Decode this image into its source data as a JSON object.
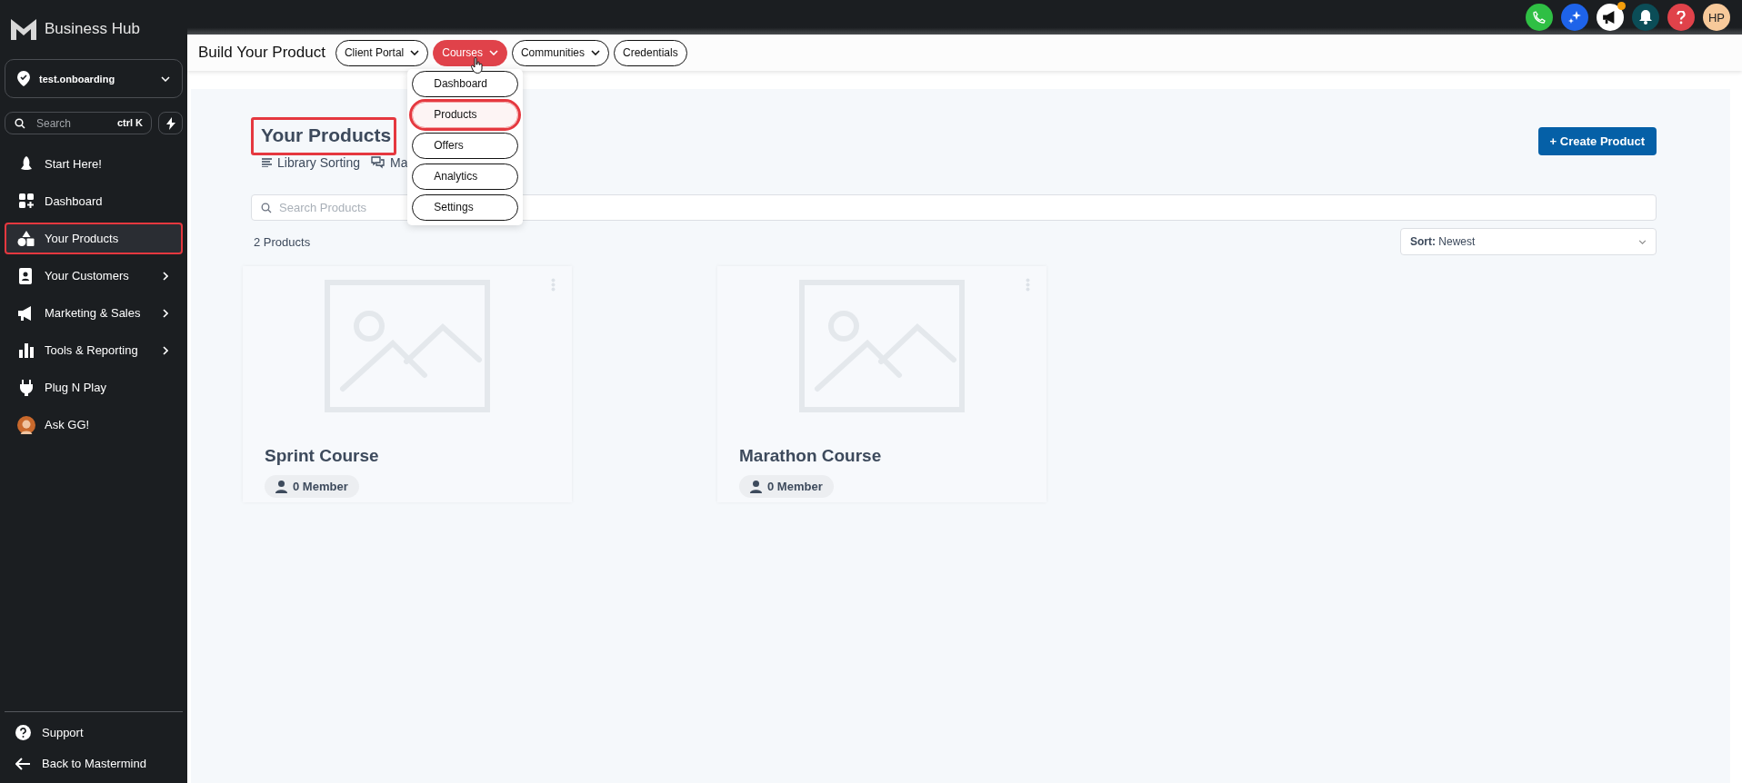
{
  "sidebar": {
    "brand": "Business Hub",
    "location": "test.onboarding",
    "search": {
      "placeholder": "Search",
      "shortcut": "ctrl K"
    },
    "items": [
      {
        "label": "Start Here!",
        "has_submenu": false,
        "selected": false,
        "annotated": false
      },
      {
        "label": "Dashboard",
        "has_submenu": false,
        "selected": false,
        "annotated": false
      },
      {
        "label": "Your Products",
        "has_submenu": false,
        "selected": true,
        "annotated": true
      },
      {
        "label": "Your Customers",
        "has_submenu": true,
        "selected": false,
        "annotated": false
      },
      {
        "label": "Marketing & Sales",
        "has_submenu": true,
        "selected": false,
        "annotated": false
      },
      {
        "label": "Tools & Reporting",
        "has_submenu": true,
        "selected": false,
        "annotated": false
      },
      {
        "label": "Plug N Play",
        "has_submenu": false,
        "selected": false,
        "annotated": false
      },
      {
        "label": "Ask GG!",
        "has_submenu": false,
        "selected": false,
        "annotated": false
      }
    ],
    "footer": [
      "Support",
      "Back to Mastermind"
    ]
  },
  "topbar": {
    "notification_dot": true,
    "avatar_initials": "HP"
  },
  "header": {
    "title": "Build Your Product",
    "tabs": [
      {
        "label": "Client Portal",
        "has_menu": true,
        "selected": false
      },
      {
        "label": "Courses",
        "has_menu": true,
        "selected": true
      },
      {
        "label": "Communities",
        "has_menu": true,
        "selected": false
      },
      {
        "label": "Credentials",
        "has_menu": false,
        "selected": false
      }
    ],
    "menu": [
      {
        "label": "Dashboard",
        "selected": false,
        "annotated": false
      },
      {
        "label": "Products",
        "selected": true,
        "annotated": true
      },
      {
        "label": "Offers",
        "selected": false,
        "annotated": false
      },
      {
        "label": "Analytics",
        "selected": false,
        "annotated": false
      },
      {
        "label": "Settings",
        "selected": false,
        "annotated": false
      }
    ]
  },
  "page": {
    "title": "Your Products",
    "title_annotated": true,
    "create_button": "+ Create Product",
    "links": [
      "Library Sorting",
      "Ma"
    ],
    "search": {
      "placeholder": "Search Products"
    },
    "count": "2 Products",
    "sort": {
      "label": "Sort:",
      "value": "Newest"
    },
    "products": [
      {
        "name": "Sprint Course",
        "members": "0 Member"
      },
      {
        "name": "Marathon Course",
        "members": "0 Member"
      }
    ]
  }
}
